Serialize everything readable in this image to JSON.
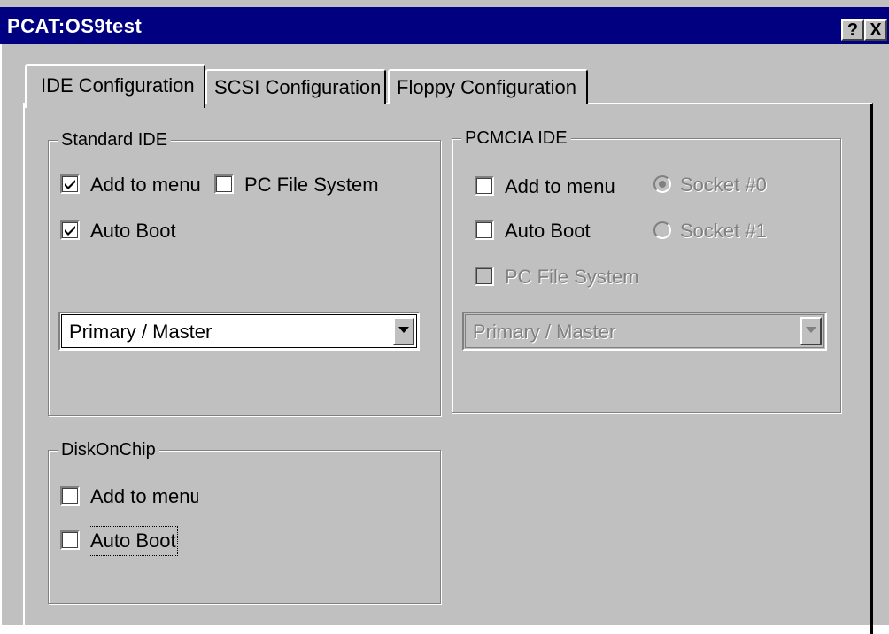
{
  "window": {
    "title": "PCAT:OS9test",
    "help_button": "?",
    "close_button": "X"
  },
  "tabs": [
    {
      "label": "IDE Configuration",
      "selected": true
    },
    {
      "label": "SCSI Configuration",
      "selected": false
    },
    {
      "label": "Floppy Configuration",
      "selected": false
    }
  ],
  "standard_ide": {
    "title": "Standard IDE",
    "add_to_menu": {
      "label": "Add to menu",
      "checked": true
    },
    "pc_file_system": {
      "label": "PC File System",
      "checked": false
    },
    "auto_boot": {
      "label": "Auto Boot",
      "checked": true
    },
    "drive_select": {
      "value": "Primary / Master"
    }
  },
  "pcmcia_ide": {
    "title": "PCMCIA IDE",
    "add_to_menu": {
      "label": "Add to menu",
      "checked": false
    },
    "auto_boot": {
      "label": "Auto Boot",
      "checked": false
    },
    "pc_file_system": {
      "label": "PC File System",
      "checked": false,
      "enabled": false
    },
    "socket0": {
      "label": "Socket #0",
      "selected": true,
      "enabled": false
    },
    "socket1": {
      "label": "Socket #1",
      "selected": false,
      "enabled": false
    },
    "drive_select": {
      "value": "Primary / Master",
      "enabled": false
    }
  },
  "disk_on_chip": {
    "title": "DiskOnChip",
    "add_to_menu": {
      "label": "Add to menu",
      "checked": false
    },
    "auto_boot": {
      "label": "Auto Boot",
      "checked": false,
      "focused": true
    }
  },
  "colors": {
    "title_bar": "#000080",
    "face": "#c0c0c0",
    "disabled_text": "#808080"
  },
  "icons": {
    "check": "checkmark-icon",
    "dropdown": "chevron-down-icon"
  }
}
